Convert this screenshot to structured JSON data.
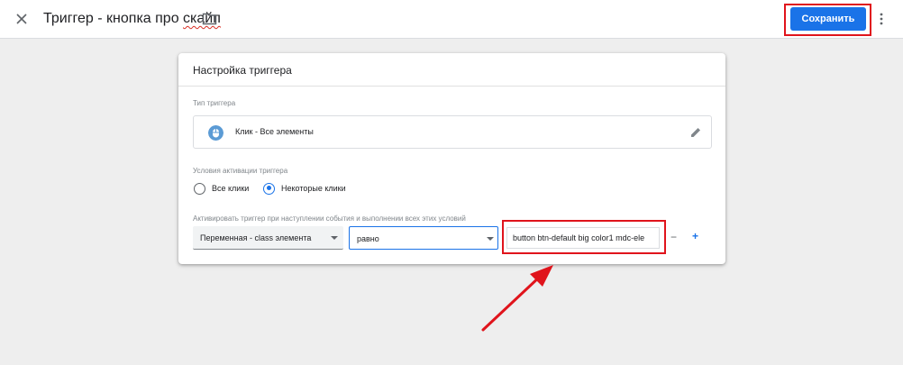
{
  "topbar": {
    "title_main": "Триггер - кнопка про ",
    "title_underlined": "скайп",
    "save_label": "Сохранить"
  },
  "card": {
    "header": "Настройка триггера",
    "trigger_type_label": "Тип триггера",
    "trigger_type_value": "Клик - Все элементы",
    "conditions_label": "Условия активации триггера",
    "radio_all": "Все клики",
    "radio_some": "Некоторые клики",
    "filter_label": "Активировать триггер при наступлении события и выполнении всех этих условий",
    "filter": {
      "variable": "Переменная - class элемента",
      "operator": "равно",
      "value": "button btn-default big color1 mdc-ele"
    },
    "minus": "−",
    "plus": "+"
  },
  "colors": {
    "accent": "#1a73e8",
    "highlight": "#e0141c"
  }
}
